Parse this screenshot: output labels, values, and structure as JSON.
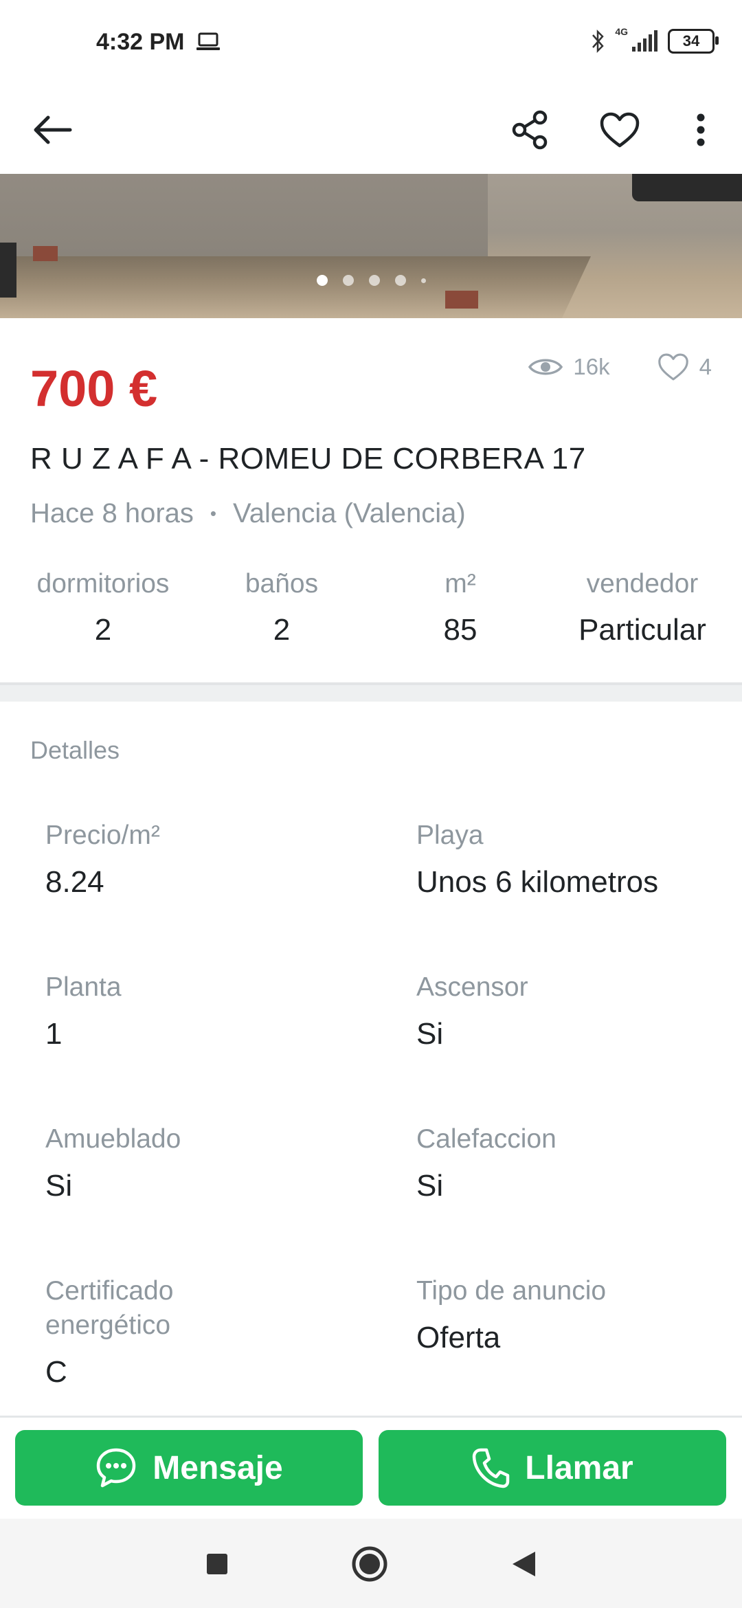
{
  "status_bar": {
    "time": "4:32 PM",
    "network": "4G",
    "battery": "34"
  },
  "toolbar": {
    "back_icon": "arrow-left-icon",
    "share_icon": "share-icon",
    "favorite_icon": "heart-outline-icon",
    "more_icon": "more-vert-icon"
  },
  "gallery": {
    "page_count": 5,
    "active_index": 0
  },
  "listing": {
    "price": "700 €",
    "views": "16k",
    "likes": "4",
    "title": "R U Z A F A - ROMEU DE CORBERA 17",
    "posted": "Hace 8 horas",
    "bullet": "•",
    "location": "Valencia (Valencia)"
  },
  "specs": [
    {
      "label": "dormitorios",
      "value": "2"
    },
    {
      "label": "baños",
      "value": "2"
    },
    {
      "label": "m²",
      "value": "85"
    },
    {
      "label": "vendedor",
      "value": "Particular"
    }
  ],
  "details": {
    "title": "Detalles",
    "items": [
      {
        "key": "Precio/m²",
        "value": "8.24"
      },
      {
        "key": "Playa",
        "value": "Unos 6 kilometros"
      },
      {
        "key": "Planta",
        "value": "1"
      },
      {
        "key": "Ascensor",
        "value": "Si"
      },
      {
        "key": "Amueblado",
        "value": "Si"
      },
      {
        "key": "Calefaccion",
        "value": "Si"
      },
      {
        "key": "Certificado energético",
        "value": "C"
      },
      {
        "key": "Tipo de anuncio",
        "value": "Oferta"
      }
    ]
  },
  "actions": {
    "message_label": "Mensaje",
    "call_label": "Llamar",
    "accent": "#1fba5a"
  },
  "colors": {
    "price": "#d32f2f",
    "muted_text": "#8e979e"
  }
}
